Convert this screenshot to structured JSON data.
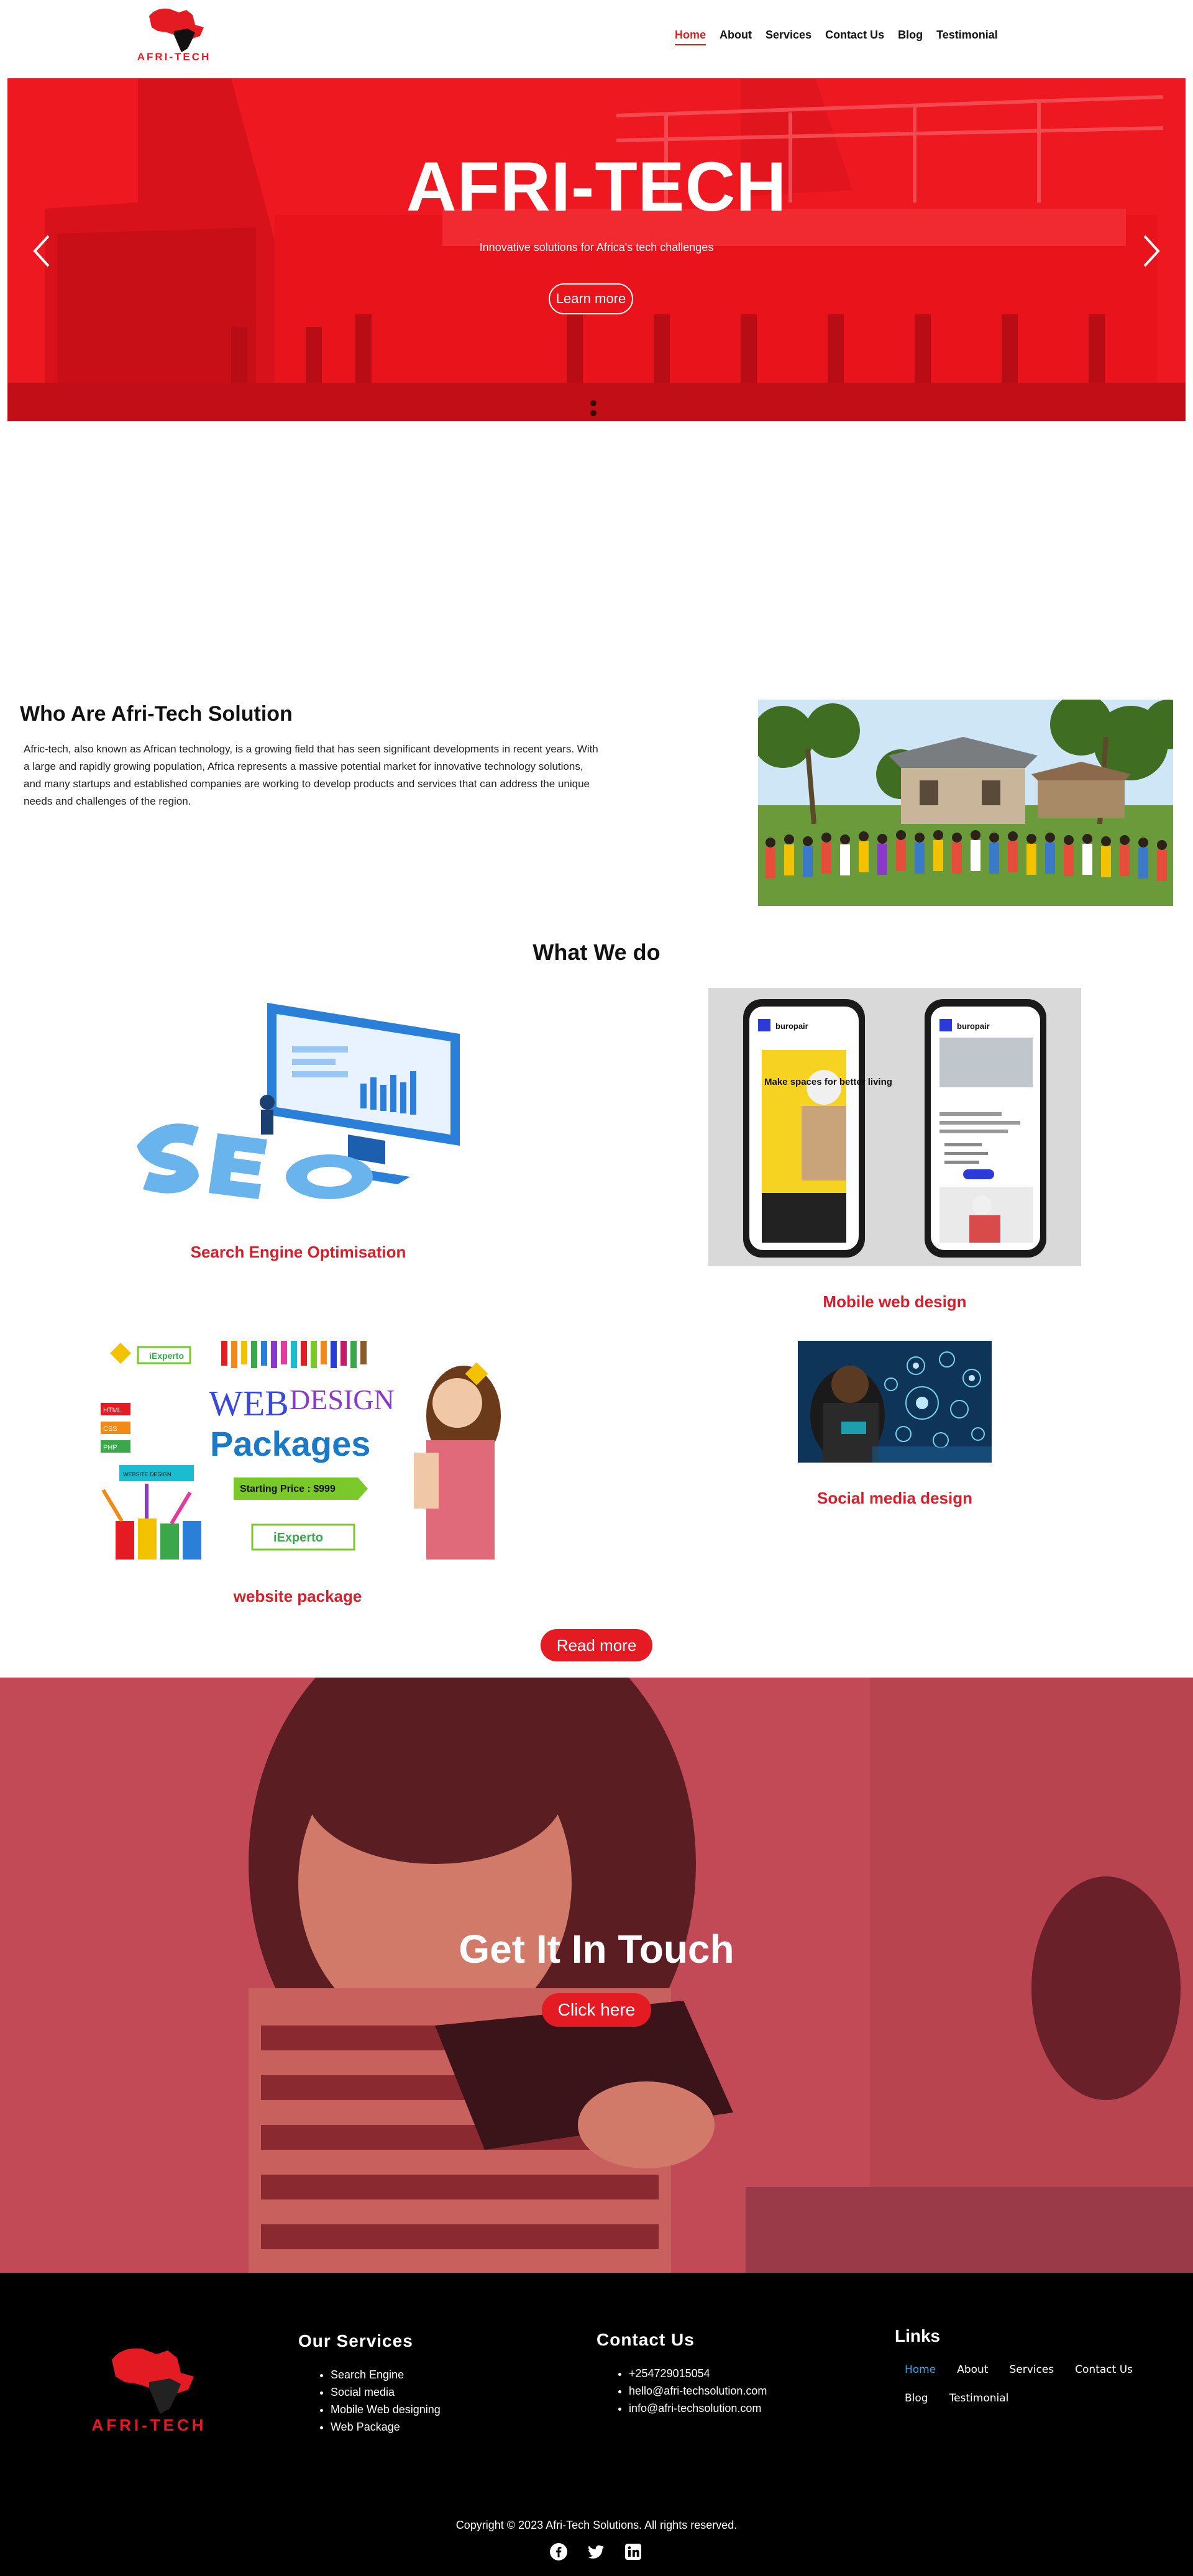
{
  "brand": {
    "name": "AFRI-TECH",
    "accent": "#e41b23"
  },
  "nav": {
    "items": [
      {
        "label": "Home",
        "active": true
      },
      {
        "label": "About",
        "active": false
      },
      {
        "label": "Services",
        "active": false
      },
      {
        "label": "Contact Us",
        "active": false
      },
      {
        "label": "Blog",
        "active": false
      },
      {
        "label": "Testimonial",
        "active": false
      }
    ]
  },
  "hero": {
    "title": "AFRI-TECH",
    "subtitle": "Innovative solutions for Africa's tech challenges",
    "button": "Learn more",
    "slide_count": 2,
    "active_slide": 1
  },
  "about": {
    "title": "Who Are Afri-Tech Solution",
    "text": "Afric-tech, also known as African technology, is a growing field that has seen significant developments in recent years. With a large and rapidly growing population, Africa represents a massive potential market for innovative technology solutions, and many startups and established companies are working to develop products and services that can address the unique needs and challenges of the region."
  },
  "services": {
    "title": "What We do",
    "items": [
      {
        "label": "Search Engine Optimisation"
      },
      {
        "label": "Mobile web design"
      },
      {
        "label": "website package"
      },
      {
        "label": "Social media design"
      }
    ],
    "read_more": "Read more",
    "package_image": {
      "tag1": "iExperto",
      "web": "WEB",
      "design": "DESIGN",
      "packages": "Packages",
      "price": "Starting Price : $999",
      "tag2": "iExperto",
      "html": "HTML",
      "css": "CSS",
      "php": "PHP",
      "website_design": "WEBSITE DESIGN"
    },
    "mobile_image": {
      "brand": "buropair",
      "headline": "Make spaces for better living"
    }
  },
  "contact_banner": {
    "title": "Get It In Touch",
    "button": "Click here"
  },
  "footer": {
    "logo_text": "AFRI-TECH",
    "services": {
      "title": "Our Services",
      "items": [
        "Search Engine",
        "Social media",
        "Mobile Web designing",
        "Web Package"
      ]
    },
    "contact": {
      "title": "Contact Us",
      "items": [
        "+254729015054",
        "hello@afri-techsolution.com",
        "info@afri-techsolution.com"
      ]
    },
    "links": {
      "title": "Links",
      "items": [
        "Home",
        "About",
        "Services",
        "Contact Us",
        "Blog",
        "Testimonial"
      ]
    },
    "copyright": "Copyright © 2023 Afri-Tech Solutions. All rights reserved.",
    "socials": [
      "facebook-icon",
      "twitter-icon",
      "linkedin-icon"
    ]
  }
}
